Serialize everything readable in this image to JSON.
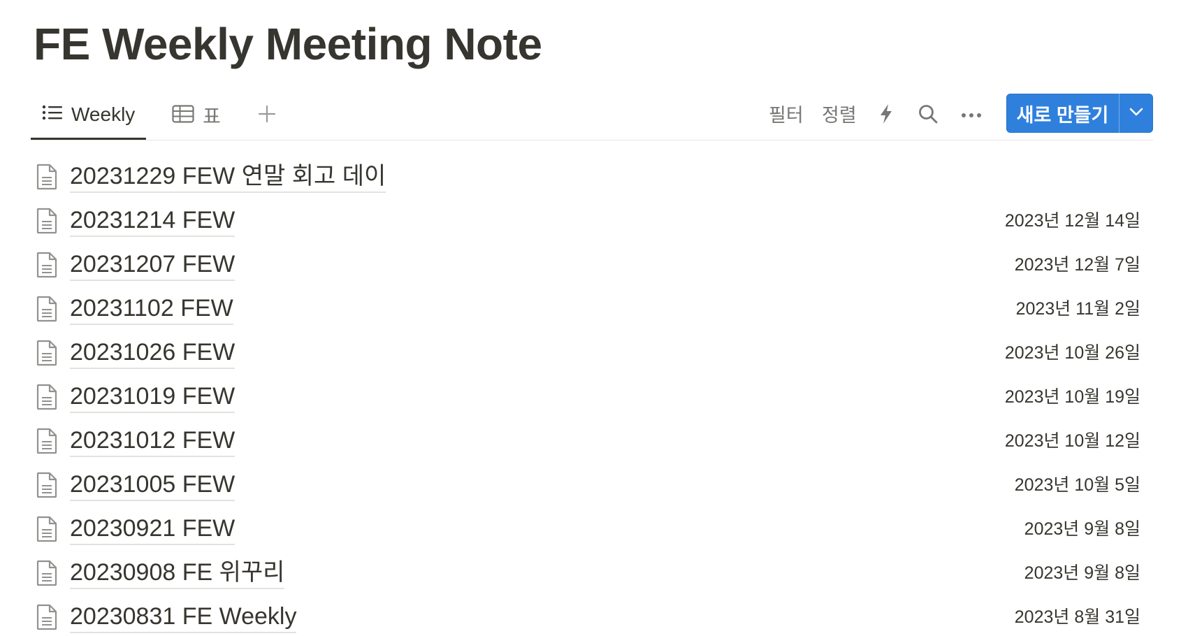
{
  "page": {
    "title": "FE Weekly Meeting Note"
  },
  "views": {
    "tabs": [
      {
        "label": "Weekly",
        "icon": "list-icon",
        "active": true
      },
      {
        "label": "표",
        "icon": "table-icon",
        "active": false
      }
    ],
    "add_view_icon": "plus-icon"
  },
  "toolbar": {
    "filter_label": "필터",
    "sort_label": "정렬",
    "automation_icon": "lightning-icon",
    "search_icon": "search-icon",
    "more_icon": "more-icon",
    "new_label": "새로 만들기",
    "new_caret_icon": "chevron-down-icon"
  },
  "colors": {
    "text": "#37352f",
    "muted": "#787774",
    "accent": "#2f80dd"
  },
  "rows": [
    {
      "title": "20231229 FEW 연말 회고 데이",
      "date": ""
    },
    {
      "title": "20231214 FEW",
      "date": "2023년 12월 14일"
    },
    {
      "title": "20231207 FEW",
      "date": "2023년 12월 7일"
    },
    {
      "title": "20231102 FEW",
      "date": "2023년 11월 2일"
    },
    {
      "title": "20231026 FEW",
      "date": "2023년 10월 26일"
    },
    {
      "title": "20231019 FEW",
      "date": "2023년 10월 19일"
    },
    {
      "title": "20231012 FEW",
      "date": "2023년 10월 12일"
    },
    {
      "title": "20231005 FEW",
      "date": "2023년 10월 5일"
    },
    {
      "title": "20230921 FEW",
      "date": "2023년 9월 8일"
    },
    {
      "title": "20230908 FE 위꾸리",
      "date": "2023년 9월 8일"
    },
    {
      "title": "20230831 FE Weekly",
      "date": "2023년 8월 31일"
    }
  ]
}
